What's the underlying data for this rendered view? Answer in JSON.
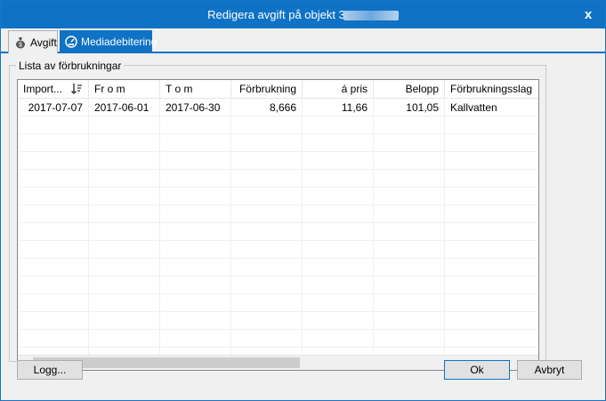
{
  "window": {
    "title": "Redigera avgift på objekt 3",
    "close_label": "x"
  },
  "tabs": [
    {
      "label": "Avgift",
      "icon": "money-bag-icon",
      "active": false
    },
    {
      "label": "Mediadebitering",
      "icon": "meter-icon",
      "active": true
    }
  ],
  "group": {
    "label": "Lista av förbrukningar"
  },
  "table": {
    "columns": [
      "Import...",
      "Fr o m",
      "T o m",
      "Förbrukning",
      "á pris",
      "Belopp",
      "Förbrukningsslag"
    ],
    "rows": [
      [
        "2017-07-07",
        "2017-06-01",
        "2017-06-30",
        "8,666",
        "11,66",
        "101,05",
        "Kallvatten"
      ]
    ],
    "empty_rows": 14
  },
  "buttons": {
    "log": "Logg...",
    "ok": "Ok",
    "cancel": "Avbryt"
  },
  "colors": {
    "accent": "#0f72c5",
    "window_bg": "#f0f0f0"
  }
}
